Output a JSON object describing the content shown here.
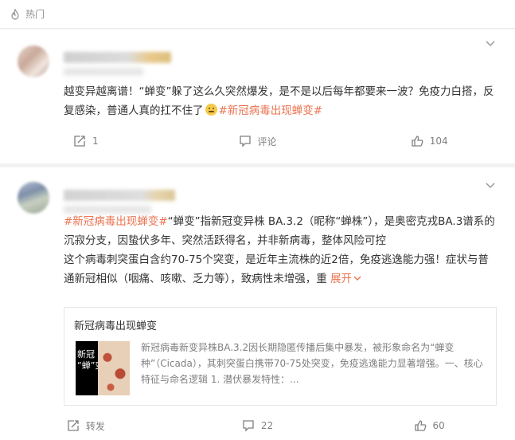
{
  "header": {
    "label": "热门"
  },
  "post1": {
    "text_before": "越变异越离谱！“蝉变”躲了这么久突然爆发，是不是以后每年都要来一波？免疫力白搭，反复感染，普通人真的扛不住了",
    "emoji": "grimace-emoji",
    "tag": "#新冠病毒出现蝉变#",
    "actions": {
      "repost": "1",
      "comment": "评论",
      "like": "104"
    }
  },
  "post2": {
    "tag": "#新冠病毒出现蝉变#",
    "text_after_tag": "“蝉变”指新冠变异株 BA.3.2（昵称“蝉株”），是奥密克戎BA.3谱系的沉寂分支，因蛰伏多年、突然活跃得名，并非新病毒，整体风险可控",
    "text_para2": "这个病毒刺突蛋白含约70-75个突变，是近年主流株的近2倍，免疫逃逸能力强！症状与普通新冠相似（咽痛、咳嗽、乏力等），致病性未增强，重",
    "more_label": "展开",
    "article": {
      "title": "新冠病毒出现蝉变",
      "thumb_text": "新冠\n“蝉”变",
      "desc": "新冠病毒新变异株BA.3.2因长期隐匿传播后集中暴发，被形象命名为“蝉变种”（Cicada），其刺突蛋白携带70-75处突变，免疫逃逸能力显著增强。一、核心特征与命名逻辑 1. 潜伏暴发特性：..."
    },
    "actions": {
      "repost": "转发",
      "comment": "22",
      "like": "60"
    }
  },
  "colors": {
    "accent": "#eb7350",
    "muted": "#808080",
    "background": "#f2f2f2"
  }
}
